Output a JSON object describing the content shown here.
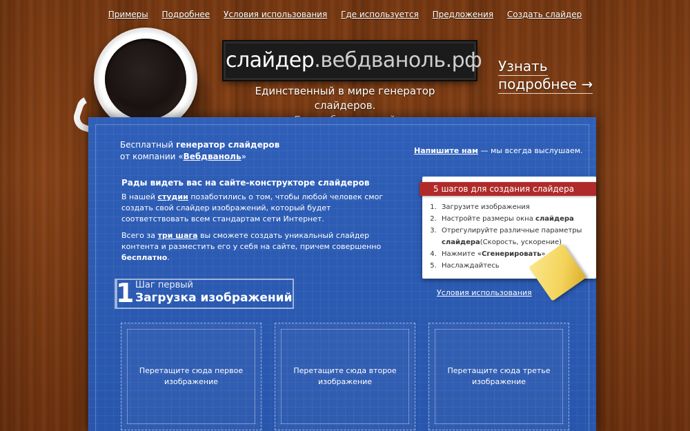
{
  "nav": [
    "Примеры",
    "Подробнее",
    "Условия использования",
    "Где используется",
    "Предложения",
    "Создать слайдер"
  ],
  "logo": {
    "bold": "слайдер",
    "rest": ".вебдваноль.рф"
  },
  "tagline": {
    "line1": "Единственный в мире генератор слайдеров.",
    "line2": "Еще и бесплатный"
  },
  "more_link": {
    "line1": "Узнать",
    "line2": "подробнее →"
  },
  "intro": {
    "line1_prefix": "Бесплатный ",
    "line1_bold": "генератор слайдеров",
    "line2_prefix": "от компании «",
    "line2_link": "Вебдваноль",
    "line2_suffix": "»"
  },
  "contact": {
    "link": "Напишите нам",
    "text": " — мы всегда выслушаем."
  },
  "welcome_heading": "Рады видеть вас на сайте-конструкторе слайдеров",
  "paragraph1": {
    "prefix": "В нашей ",
    "link": "студии",
    "suffix": " позаботились о том, чтобы любой человек смог создать свой слайдер изображений, который будет соответствовать всем стандартам сети Интернет."
  },
  "paragraph2": {
    "prefix": "Всего за ",
    "link": "три шага",
    "middle": " вы сможете создать уникальный слайдер контента и разместить его у себя на сайте, причем совершенно ",
    "bold": "бесплатно",
    "suffix": "."
  },
  "steps_card": {
    "title": "5 шагов для создания слайдера",
    "items": [
      {
        "text": "Загрузите изображения",
        "bold": ""
      },
      {
        "text": "Настройте размеры окна ",
        "bold": "слайдера"
      },
      {
        "text": "Отрегулируйте различные параметры ",
        "bold": "слайдера",
        "after": "(Скорость, ускорение)"
      },
      {
        "text": "Нажмите «",
        "bold": "Сгенерировать",
        "after": "»"
      },
      {
        "text": "Наслаждайтесь",
        "bold": ""
      }
    ]
  },
  "terms_link": "Условия использования",
  "step1": {
    "number": "1",
    "subtitle": "Шаг первый",
    "title": "Загрузка изображений"
  },
  "dropzones": [
    {
      "line1": "Перетащите сюда первое",
      "line2": "изображение"
    },
    {
      "line1": "Перетащите сюда второе",
      "line2": "изображение"
    },
    {
      "line1": "Перетащите сюда третье",
      "line2": "изображение"
    }
  ]
}
